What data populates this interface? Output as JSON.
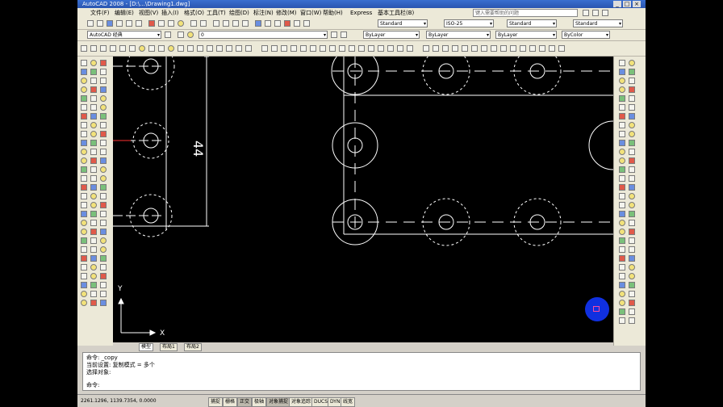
{
  "title": "AutoCAD 2008 - [D:\\...\\Drawing1.dwg]",
  "menu": [
    "文件(F)",
    "编辑(E)",
    "视图(V)",
    "插入(I)",
    "格式(O)",
    "工具(T)",
    "绘图(D)",
    "标注(N)",
    "修改(M)",
    "窗口(W)",
    "帮助(H)",
    "Express",
    "基本工具栏(B)"
  ],
  "search_placeholder": "键入需要帮助的问题",
  "toolbar": {
    "workspace": "AutoCAD 经典",
    "text_style": "Standard",
    "dim_style": "ISO-25",
    "table_style": "Standard",
    "mleader_style": "Standard",
    "layer": "0",
    "color": "ByLayer",
    "linetype": "ByLayer",
    "lineweight": "ByLayer",
    "plotstyle": "ByColor"
  },
  "drawing": {
    "dimension_text": "44",
    "ucs_y": "Y",
    "ucs_x": "X"
  },
  "tabs": [
    "模型",
    "布局1",
    "布局2"
  ],
  "command_lines": [
    "命令: _copy",
    "当前设置: 复制模式 = 多个",
    "选择对象:"
  ],
  "command_prompt": "命令:",
  "status": {
    "coords": "2261.1296, 1139.7354, 0.0000",
    "buttons": [
      "捕捉",
      "栅格",
      "正交",
      "极轴",
      "对象捕捉",
      "对象追踪",
      "DUCS",
      "DYN",
      "线宽"
    ]
  }
}
